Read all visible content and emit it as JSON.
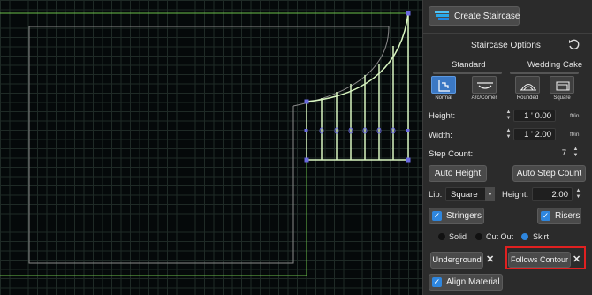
{
  "toolbar": {
    "create_label": "Create Staircase"
  },
  "panel": {
    "title": "Staircase Options",
    "groups": {
      "standard": "Standard",
      "wedding_cake": "Wedding Cake"
    },
    "types": [
      {
        "label": "Normal",
        "icon": "normal-stair-icon",
        "active": true
      },
      {
        "label": "Arc/Corner",
        "icon": "arc-stair-icon",
        "active": false
      },
      {
        "label": "Rounded",
        "icon": "rounded-stair-icon",
        "active": false
      },
      {
        "label": "Square",
        "icon": "square-stair-icon",
        "active": false
      }
    ],
    "height": {
      "label": "Height:",
      "value": "1 ' 0.00",
      "unit": "ft/in"
    },
    "width": {
      "label": "Width:",
      "value": "1 ' 2.00",
      "unit": "ft/in"
    },
    "step_count": {
      "label": "Step Count:",
      "value": "7"
    },
    "auto_height_label": "Auto Height",
    "auto_step_label": "Auto Step Count",
    "lip": {
      "label": "Lip:",
      "value": "Square"
    },
    "lip_height": {
      "label": "Height:",
      "value": "2.00"
    },
    "stringers_label": "Stringers",
    "risers_label": "Risers",
    "radios": [
      {
        "label": "Solid",
        "selected": false
      },
      {
        "label": "Cut Out",
        "selected": false
      },
      {
        "label": "Skirt",
        "selected": true
      }
    ],
    "underground_label": "Underground",
    "follows_contour_label": "Follows Contour",
    "align_material_label": "Align Material"
  },
  "colors": {
    "accent": "#2e86de",
    "highlight": "#e02020",
    "outline": "#7fd060",
    "stairs": "#c8f0a0",
    "handle": "#6a6ae0"
  }
}
